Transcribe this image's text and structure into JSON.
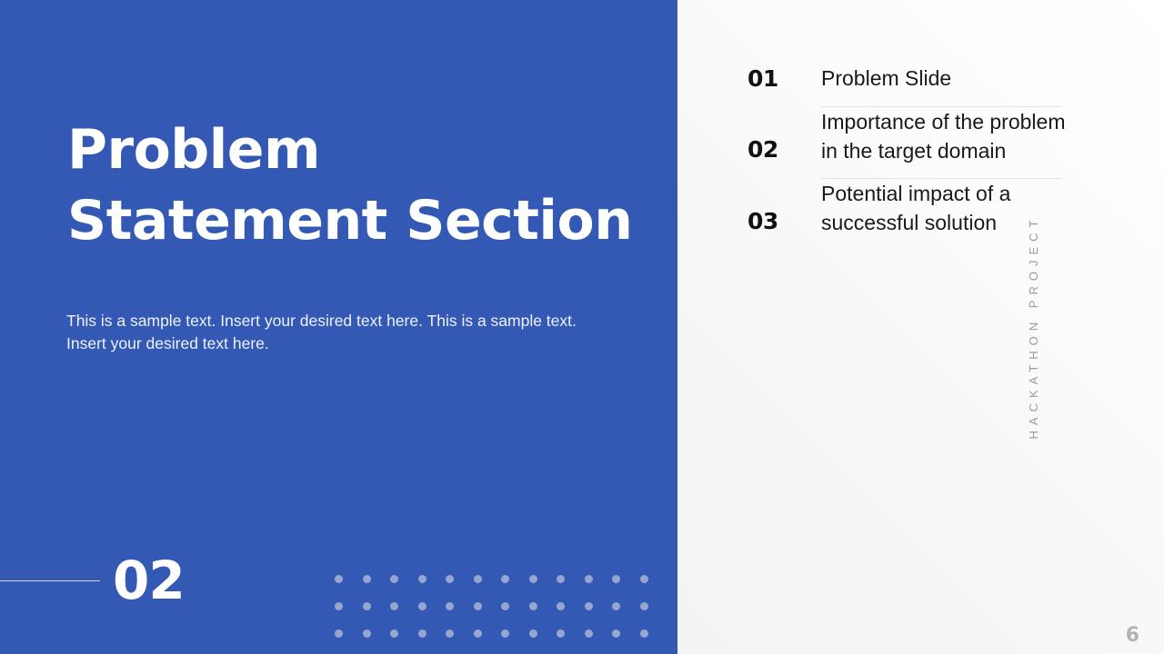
{
  "slide": {
    "title": "Problem\nStatement Section",
    "body_text": "This is a sample text. Insert your desired text here. This is a sample text. Insert your desired text here.",
    "section_number": "02",
    "page_number": "6",
    "side_label": "HACKATHON PROJECT",
    "colors": {
      "panel_blue": "#3459b4",
      "panel_light": "#f5f5f5",
      "title_white": "#ffffff",
      "dot_grid": "#97a6ce",
      "divider": "#e2e2e2",
      "page_number": "#b3b3b3",
      "side_label": "#9b9b9b"
    }
  },
  "agenda": {
    "items": [
      {
        "number": "01",
        "label": "Problem Slide"
      },
      {
        "number": "02",
        "label": "Importance of the problem in the target domain"
      },
      {
        "number": "03",
        "label": "Potential impact of a successful solution"
      }
    ]
  },
  "dot_grid": {
    "columns": 12,
    "rows": 3
  }
}
